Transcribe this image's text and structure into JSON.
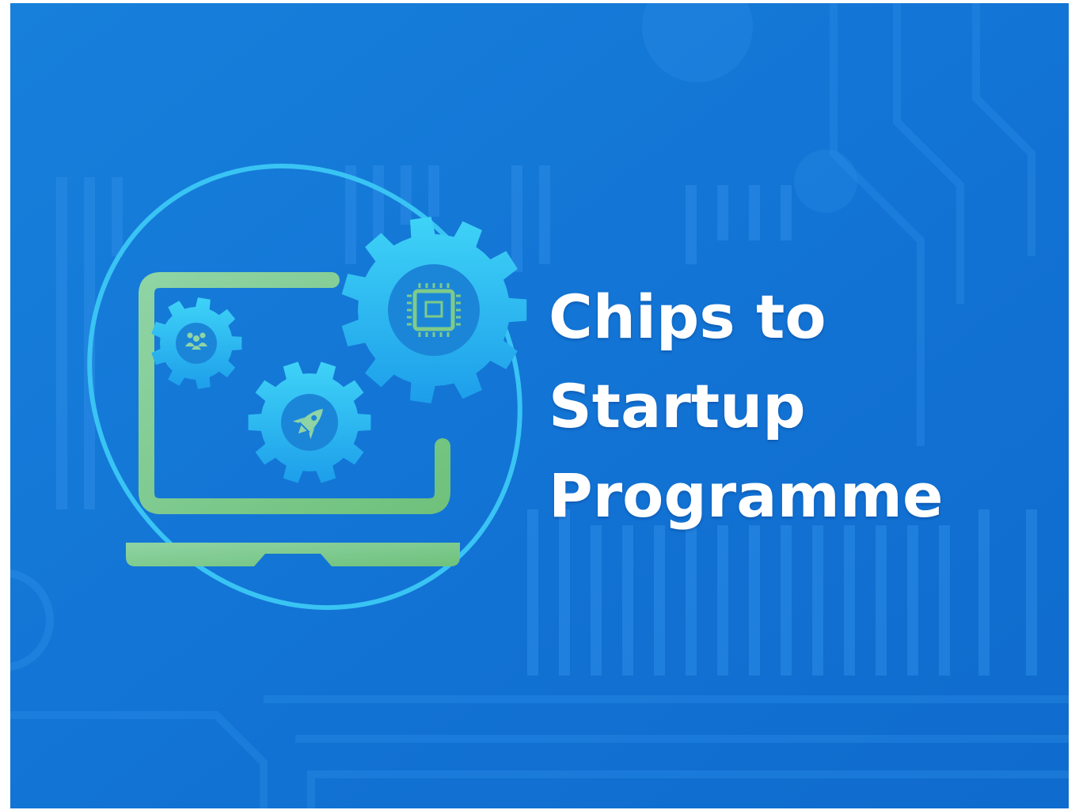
{
  "banner": {
    "title_lines": [
      "Chips to",
      "Startup",
      "Programme"
    ]
  },
  "icons": {
    "logo": "laptop-with-gears-icon",
    "large_gear": "chip-gear-icon",
    "small_gear": "people-gear-icon",
    "medium_gear": "rocket-gear-icon"
  },
  "colors": {
    "background": "#1273d4",
    "orbit": "#39c4f4",
    "laptop": "#7ecb8a",
    "gear": "#24b2f2",
    "title_text": "#ffffff"
  }
}
